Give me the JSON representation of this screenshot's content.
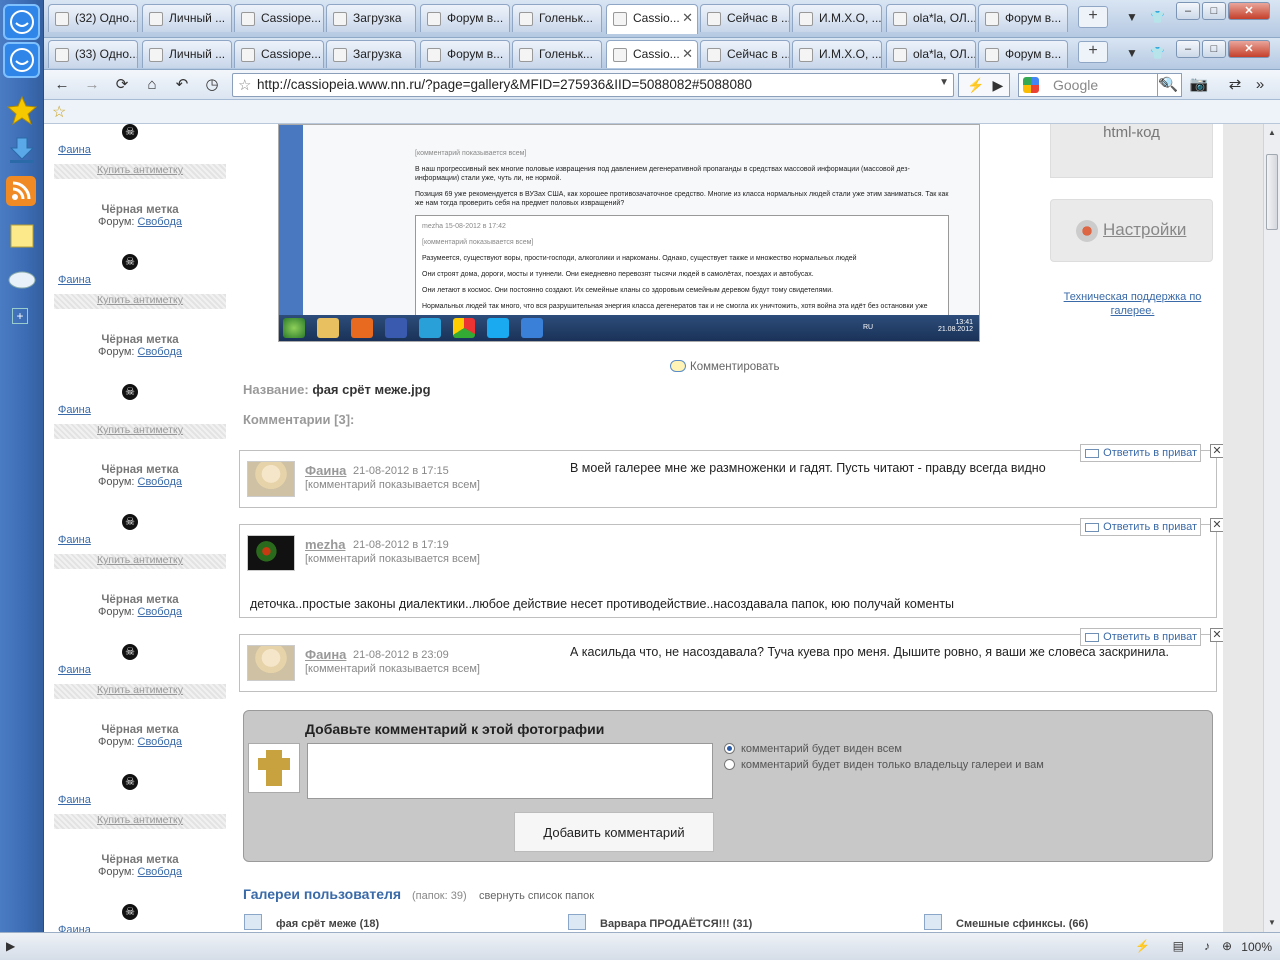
{
  "browser": {
    "tabs_row1": [
      "(32) Одно...",
      "Личный ...",
      "Cassiope...",
      "Загрузка",
      "Форум в...",
      "Голеньк...",
      "Cassio...",
      "Сейчас в ...",
      "И.М.Х.О, ...",
      "ola*la, ОЛ...",
      "Форум в..."
    ],
    "tabs_row2": [
      "(33) Одно...",
      "Личный ...",
      "Cassiope...",
      "Загрузка",
      "Форум в...",
      "Голеньк...",
      "Cassio...",
      "Сейчас в ...",
      "И.М.Х.О, ...",
      "ola*la, ОЛ...",
      "Форум в..."
    ],
    "active_tab_index": 6,
    "url": "http://cassiopeia.www.nn.ru/?page=gallery&MFID=275936&IID=5088082#5088080",
    "search_placeholder": "Google",
    "zoom": "100%"
  },
  "left_column": {
    "user": "Фаина",
    "buy": "Купить антиметку",
    "black_mark": "Чёрная метка",
    "forum_label": "Форум:",
    "forum_link": "Свобода"
  },
  "photo": {
    "embedded_text": [
      "[комментарий показывается всем]",
      "В наш прогрессивный век многие половые извращения под давлением дегенеративной пропаганды в средствах массовой информации (массовой дез-информации) стали уже, чуть ли, не нормой.",
      "Позиция 69 уже рекомендуется в ВУЗах США, как хорошее противозачаточное средство. Многие из класса нормальных людей стали уже этим заниматься. Так как же нам тогда проверить себя на предмет половых извращений?",
      "mezha 15-08-2012 в 17:42",
      "[комментарий показывается всем]",
      "Разумеется, существуют воры, прости-господи, алкоголики и наркоманы. Однако, существует также и множество нормальных людей",
      "Они строят дома, дороги, мосты и туннели. Они ежедневно перевозят тысячи людей в самолётах, поездах и автобусах.",
      "Они летают в космос. Они постоянно создают. Их семейные кланы со здоровым семейным деревом будут тому свидетелями.",
      "Нормальных людей так много, что вся разрушительная энергия класса дегенератов так и не смогла их уничтожить, хотя война эта идёт без остановки уже"
    ],
    "taskbar_time": "13:41",
    "taskbar_date": "21.08.2012",
    "taskbar_lang": "RU",
    "taskbar_zoom": "100%"
  },
  "comment_link": "Комментировать",
  "name_label": "Название:",
  "name_value": "фая срёт меже.jpg",
  "comments_label": "Комментарии [3]:",
  "comments": [
    {
      "nick": "Фаина",
      "date": "21-08-2012 в 17:15",
      "visibility": "[комментарий показывается всем]",
      "text": "В моей галерее мне же размноженки и гадят. Пусть читают - правду всегда видно",
      "reply": "Ответить в приват"
    },
    {
      "nick": "mezha",
      "date": "21-08-2012 в 17:19",
      "visibility": "[комментарий показывается всем]",
      "text": "деточка..простые законы диалектики..любое действие несет противодействие..насоздавала папок, юю получай коменты",
      "reply": "Ответить в приват"
    },
    {
      "nick": "Фаина",
      "date": "21-08-2012 в 23:09",
      "visibility": "[комментарий показывается всем]",
      "text": "А касильда что, не насоздавала? Туча куева про меня. Дышите ровно, я ваши же словеса заскринила.",
      "reply": "Ответить в приват"
    }
  ],
  "add_comment": {
    "title": "Добавьте комментарий к этой фотографии",
    "option_all": "комментарий будет виден всем",
    "option_owner": "комментарий будет виден только владельцу галереи и вам",
    "button": "Добавить комментарий"
  },
  "galleries": {
    "title": "Галереи пользователя",
    "count": "(папок: 39)",
    "collapse": "свернуть список папок",
    "items": [
      {
        "name": "фая срёт меже",
        "count": "(18)"
      },
      {
        "name": "Варвара ПРОДАЁТСЯ!!!",
        "count": "(31)"
      },
      {
        "name": "Смешные сфинксы.",
        "count": "(66)"
      }
    ]
  },
  "right_panel": {
    "html_code": "html-код",
    "settings": "Настройки",
    "support": "Техническая поддержка по галерее."
  }
}
